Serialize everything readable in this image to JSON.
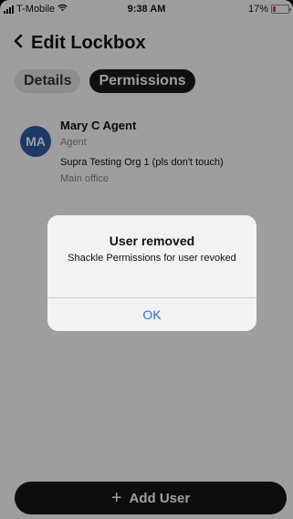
{
  "status_bar": {
    "carrier": "T-Mobile",
    "time": "9:38 AM",
    "battery_text": "17%",
    "battery_level": 0.17
  },
  "header": {
    "title": "Edit Lockbox",
    "back_icon": "chevron-left-icon"
  },
  "tabs": [
    {
      "label": "Details",
      "selected": false
    },
    {
      "label": "Permissions",
      "selected": true
    }
  ],
  "user": {
    "initials": "MA",
    "name": "Mary C Agent",
    "role": "Agent",
    "org": "Supra Testing Org 1 (pls don't touch)",
    "office": "Main office",
    "avatar_color": "#2f5da8"
  },
  "alert": {
    "title": "User removed",
    "message": "Shackle Permissions for user revoked",
    "ok_label": "OK"
  },
  "footer": {
    "add_user_label": "Add User",
    "add_icon": "plus-icon"
  }
}
